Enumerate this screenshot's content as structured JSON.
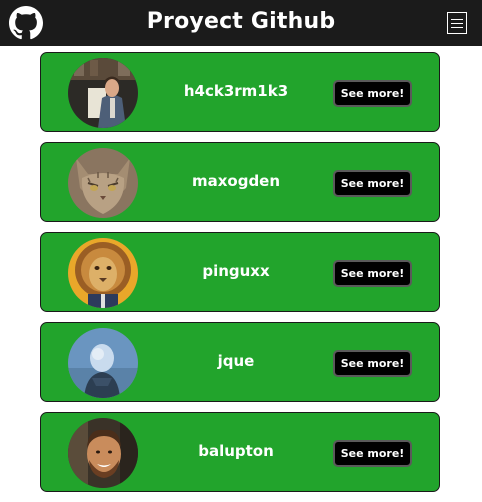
{
  "header": {
    "title": "Proyect Github",
    "logo_icon": "github-icon",
    "menu_icon": "hamburger-menu-icon",
    "background": "#1b1b1b"
  },
  "users": [
    {
      "username": "h4ck3rm1k3",
      "button_label": "See more!",
      "avatar": "photo-man-in-suit"
    },
    {
      "username": "maxogden",
      "button_label": "See more!",
      "avatar": "photo-cat"
    },
    {
      "username": "pinguxx",
      "button_label": "See more!",
      "avatar": "illustration-lion"
    },
    {
      "username": "jque",
      "button_label": "See more!",
      "avatar": "photo-blue-figure"
    },
    {
      "username": "balupton",
      "button_label": "See more!",
      "avatar": "photo-smiling-man"
    }
  ],
  "colors": {
    "card_background": "#22a42c",
    "button_background": "#000000",
    "text": "#ffffff"
  }
}
